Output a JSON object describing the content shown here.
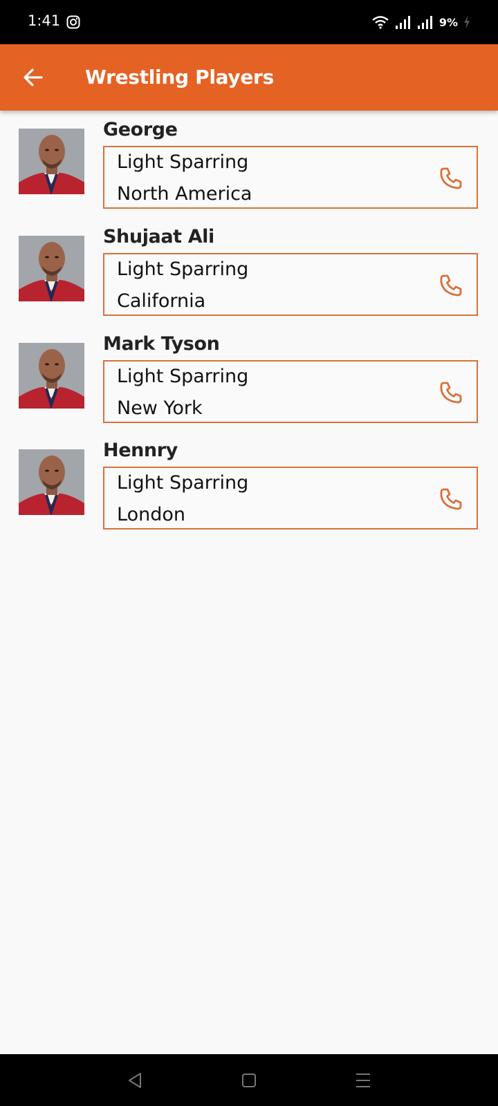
{
  "status_bar": {
    "time": "1:41",
    "battery": "9%",
    "icons": [
      "instagram-icon",
      "wifi-icon",
      "signal-icon",
      "signal-icon",
      "battery-charging-icon"
    ]
  },
  "app_bar": {
    "title": "Wrestling Players",
    "background_color": "#e46224",
    "back_icon": "arrow-back-icon"
  },
  "accent_color": "#d9703a",
  "players": [
    {
      "name": "George",
      "style": "Light Sparring",
      "location": "North America"
    },
    {
      "name": "Shujaat Ali",
      "style": "Light Sparring",
      "location": "California"
    },
    {
      "name": "Mark Tyson",
      "style": "Light Sparring",
      "location": "New York"
    },
    {
      "name": "Hennry",
      "style": "Light Sparring",
      "location": "London"
    }
  ],
  "nav_bar": {
    "icons": [
      "back-triangle-icon",
      "home-square-icon",
      "menu-lines-icon"
    ]
  }
}
